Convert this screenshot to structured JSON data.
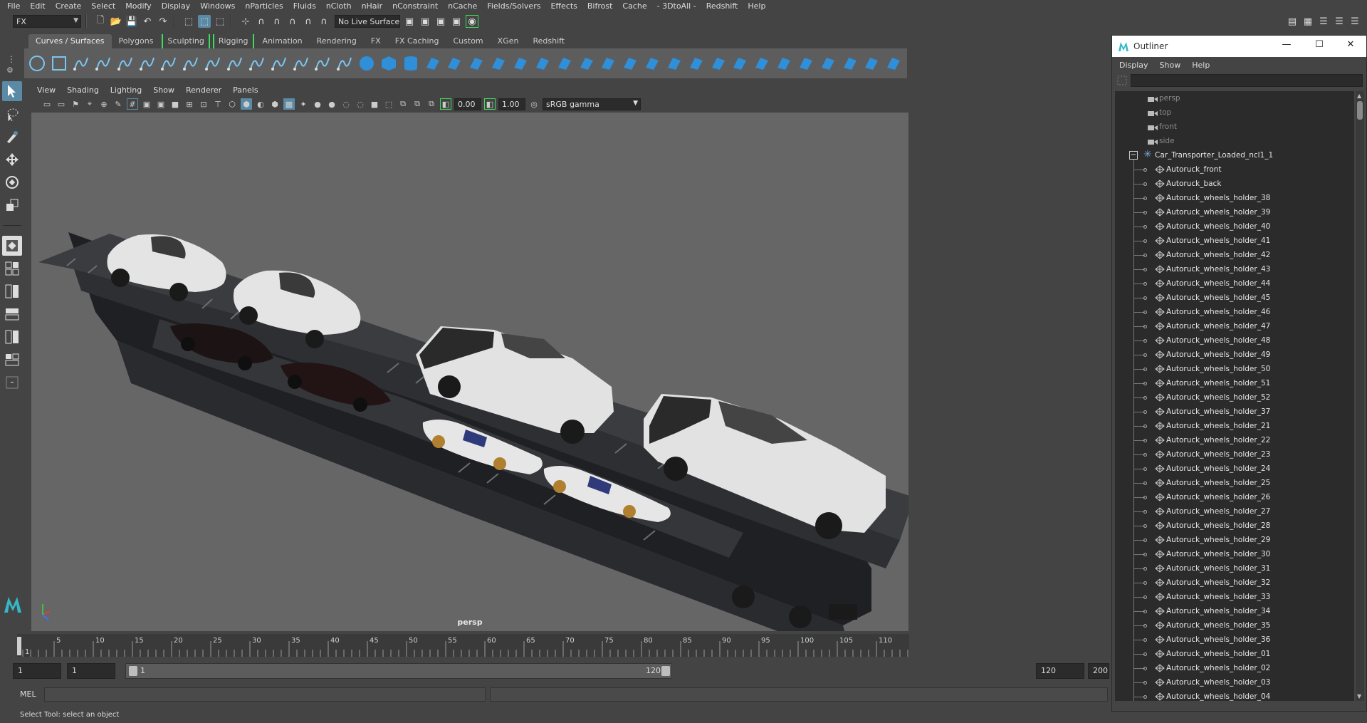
{
  "menubar": [
    "File",
    "Edit",
    "Create",
    "Select",
    "Modify",
    "Display",
    "Windows",
    "nParticles",
    "Fluids",
    "nCloth",
    "nHair",
    "nConstraint",
    "nCache",
    "Fields/Solvers",
    "Effects",
    "Bifrost",
    "Cache",
    "- 3DtoAll -",
    "Redshift",
    "Help"
  ],
  "statusline": {
    "mode": "FX",
    "live_surface": "No Live Surface"
  },
  "shelf": {
    "tabs": [
      "Curves / Surfaces",
      "Polygons",
      "Sculpting",
      "Rigging",
      "Animation",
      "Rendering",
      "FX",
      "FX Caching",
      "Custom",
      "XGen",
      "Redshift"
    ],
    "active_tab": "Curves / Surfaces"
  },
  "viewport": {
    "menu": [
      "View",
      "Shading",
      "Lighting",
      "Show",
      "Renderer",
      "Panels"
    ],
    "exposure": "0.00",
    "gamma_value": "1.00",
    "colorspace": "sRGB gamma",
    "camera_label": "persp"
  },
  "timeslider": {
    "ticks": [
      "1",
      "5",
      "10",
      "15",
      "20",
      "25",
      "30",
      "35",
      "40",
      "45",
      "50",
      "55",
      "60",
      "65",
      "70",
      "75",
      "80",
      "85",
      "90",
      "95",
      "100",
      "105",
      "110"
    ],
    "current_frame": "1"
  },
  "range": {
    "start": "1",
    "anim_start": "1",
    "range_start_label": "1",
    "range_end_label": "120",
    "anim_end": "120",
    "end": "200"
  },
  "cmdline": {
    "label": "MEL"
  },
  "helpline": {
    "text": "Select Tool: select an object"
  },
  "outliner": {
    "title": "Outliner",
    "menu": [
      "Display",
      "Show",
      "Help"
    ],
    "cameras": [
      "persp",
      "top",
      "front",
      "side"
    ],
    "root": "Car_Transporter_Loaded_ncl1_1",
    "children": [
      "Autoruck_front",
      "Autoruck_back",
      "Autoruck_wheels_holder_38",
      "Autoruck_wheels_holder_39",
      "Autoruck_wheels_holder_40",
      "Autoruck_wheels_holder_41",
      "Autoruck_wheels_holder_42",
      "Autoruck_wheels_holder_43",
      "Autoruck_wheels_holder_44",
      "Autoruck_wheels_holder_45",
      "Autoruck_wheels_holder_46",
      "Autoruck_wheels_holder_47",
      "Autoruck_wheels_holder_48",
      "Autoruck_wheels_holder_49",
      "Autoruck_wheels_holder_50",
      "Autoruck_wheels_holder_51",
      "Autoruck_wheels_holder_52",
      "Autoruck_wheels_holder_37",
      "Autoruck_wheels_holder_21",
      "Autoruck_wheels_holder_22",
      "Autoruck_wheels_holder_23",
      "Autoruck_wheels_holder_24",
      "Autoruck_wheels_holder_25",
      "Autoruck_wheels_holder_26",
      "Autoruck_wheels_holder_27",
      "Autoruck_wheels_holder_28",
      "Autoruck_wheels_holder_29",
      "Autoruck_wheels_holder_30",
      "Autoruck_wheels_holder_31",
      "Autoruck_wheels_holder_32",
      "Autoruck_wheels_holder_33",
      "Autoruck_wheels_holder_34",
      "Autoruck_wheels_holder_35",
      "Autoruck_wheels_holder_36",
      "Autoruck_wheels_holder_01",
      "Autoruck_wheels_holder_02",
      "Autoruck_wheels_holder_03",
      "Autoruck_wheels_holder_04"
    ]
  },
  "colors": {
    "accent": "#5a8aa6",
    "bracket": "#3ddc5c",
    "viewport_bg": "#666666"
  }
}
